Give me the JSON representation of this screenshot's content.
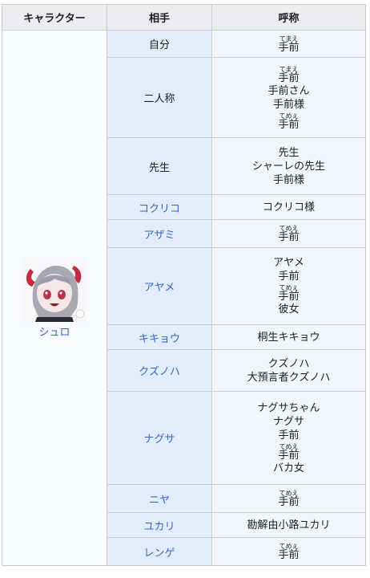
{
  "headers": {
    "character": "キャラクター",
    "partner": "相手",
    "call": "呼称"
  },
  "character": {
    "name": "シュロ",
    "avatar_icon": "shuro-portrait-icon"
  },
  "rows": [
    {
      "partner": "自分",
      "link": false,
      "h": 34,
      "items": [
        {
          "t": "r",
          "b": "手前",
          "r": "てまえ"
        }
      ]
    },
    {
      "partner": "二人称",
      "link": false,
      "h": 100,
      "items": [
        {
          "t": "r",
          "b": "手前",
          "r": "てまえ"
        },
        {
          "t": "x",
          "v": "手前さん"
        },
        {
          "t": "x",
          "v": "手前様"
        },
        {
          "t": "r",
          "b": "手前",
          "r": "てめぇ"
        }
      ]
    },
    {
      "partner": "先生",
      "link": false,
      "h": 71,
      "items": [
        {
          "t": "x",
          "v": "先生"
        },
        {
          "t": "x",
          "v": "シャーレの先生"
        },
        {
          "t": "x",
          "v": "手前様"
        }
      ]
    },
    {
      "partner": "コクリコ",
      "link": true,
      "h": 31,
      "items": [
        {
          "t": "x",
          "v": "コクリコ様"
        }
      ]
    },
    {
      "partner": "アザミ",
      "link": true,
      "h": 35,
      "items": [
        {
          "t": "r",
          "b": "手前",
          "r": "てめえ"
        }
      ]
    },
    {
      "partner": "アヤメ",
      "link": true,
      "h": 96,
      "items": [
        {
          "t": "x",
          "v": "アヤメ"
        },
        {
          "t": "x",
          "v": "手前"
        },
        {
          "t": "r",
          "b": "手前",
          "r": "てめぇ"
        },
        {
          "t": "x",
          "v": "彼女"
        }
      ]
    },
    {
      "partner": "キキョウ",
      "link": true,
      "h": 31,
      "items": [
        {
          "t": "x",
          "v": "桐生キキョウ"
        }
      ]
    },
    {
      "partner": "クズノハ",
      "link": true,
      "h": 52,
      "items": [
        {
          "t": "x",
          "v": "クズノハ"
        },
        {
          "t": "x",
          "v": "大預言者クズノハ"
        }
      ]
    },
    {
      "partner": "ナグサ",
      "link": true,
      "h": 116,
      "items": [
        {
          "t": "x",
          "v": "ナグサちゃん"
        },
        {
          "t": "x",
          "v": "ナグサ"
        },
        {
          "t": "x",
          "v": "手前"
        },
        {
          "t": "r",
          "b": "手前",
          "r": "てめえ"
        },
        {
          "t": "x",
          "v": "バカ女"
        }
      ]
    },
    {
      "partner": "ニヤ",
      "link": true,
      "h": 35,
      "items": [
        {
          "t": "r",
          "b": "手前",
          "r": "てめえ"
        }
      ]
    },
    {
      "partner": "ユカリ",
      "link": true,
      "h": 31,
      "items": [
        {
          "t": "x",
          "v": "勘解由小路ユカリ"
        }
      ]
    },
    {
      "partner": "レンゲ",
      "link": true,
      "h": 35,
      "items": [
        {
          "t": "r",
          "b": "手前",
          "r": "てめぇ"
        }
      ]
    }
  ]
}
